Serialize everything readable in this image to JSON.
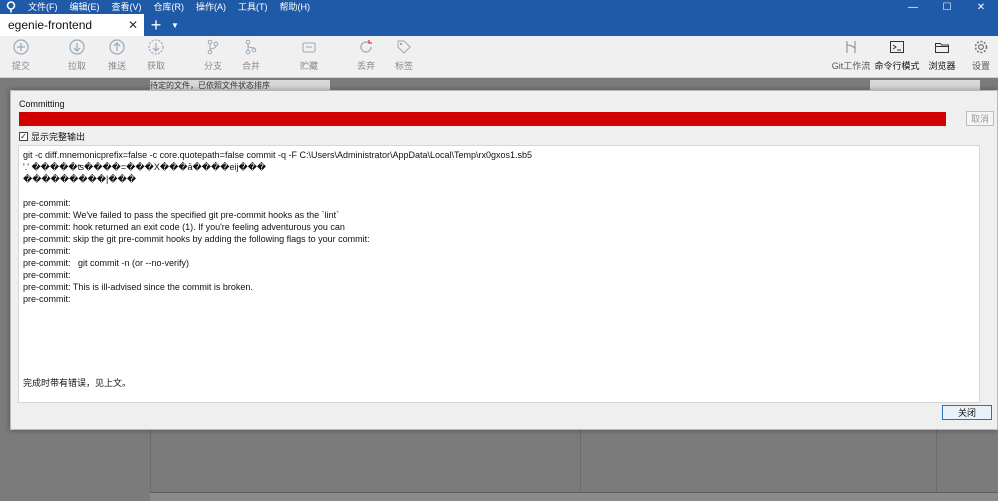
{
  "menu": [
    "文件(F)",
    "编辑(E)",
    "查看(V)",
    "仓库(R)",
    "操作(A)",
    "工具(T)",
    "帮助(H)"
  ],
  "window_controls": {
    "minimize": "—",
    "maximize": "☐",
    "close": "✕"
  },
  "tabs": [
    {
      "label": "egenie-frontend",
      "close": "✕"
    }
  ],
  "tab_add": "+",
  "tab_dropdown": "▼",
  "toolbar": {
    "commit": "提交",
    "pull": "拉取",
    "push": "推送",
    "fetch": "获取",
    "branch": "分支",
    "merge": "合并",
    "stash": "贮藏",
    "discard": "丢弃",
    "tag": "标签",
    "git_flow": "Git工作流",
    "terminal": "命令行模式",
    "explorer": "浏览器",
    "settings": "设置"
  },
  "background": {
    "filter_text": "待定的文件，已依照文件状态排序"
  },
  "dialog": {
    "title": "Committing",
    "cancel_label": "取消",
    "show_full_output_label": "显示完整输出",
    "show_full_output_checked": true,
    "progress_color": "#d10000",
    "output_lines": [
      "git -c diff.mnemonicprefix=false -c core.quotepath=false commit -q -F C:\\Users\\Administrator\\AppData\\Local\\Temp\\rx0gxos1.sb5",
      "'.' �����ʦ����=���X���ā����eij���",
      "���������|���",
      "",
      "pre-commit:",
      "pre-commit: We've failed to pass the specified git pre-commit hooks as the `lint`",
      "pre-commit: hook returned an exit code (1). If you're feeling adventurous you can",
      "pre-commit: skip the git pre-commit hooks by adding the following flags to your commit:",
      "pre-commit:",
      "pre-commit:   git commit -n (or --no-verify)",
      "pre-commit:",
      "pre-commit: This is ill-advised since the commit is broken.",
      "pre-commit:"
    ],
    "done_message": "完成时带有错误，见上文。",
    "close_label": "关闭"
  }
}
